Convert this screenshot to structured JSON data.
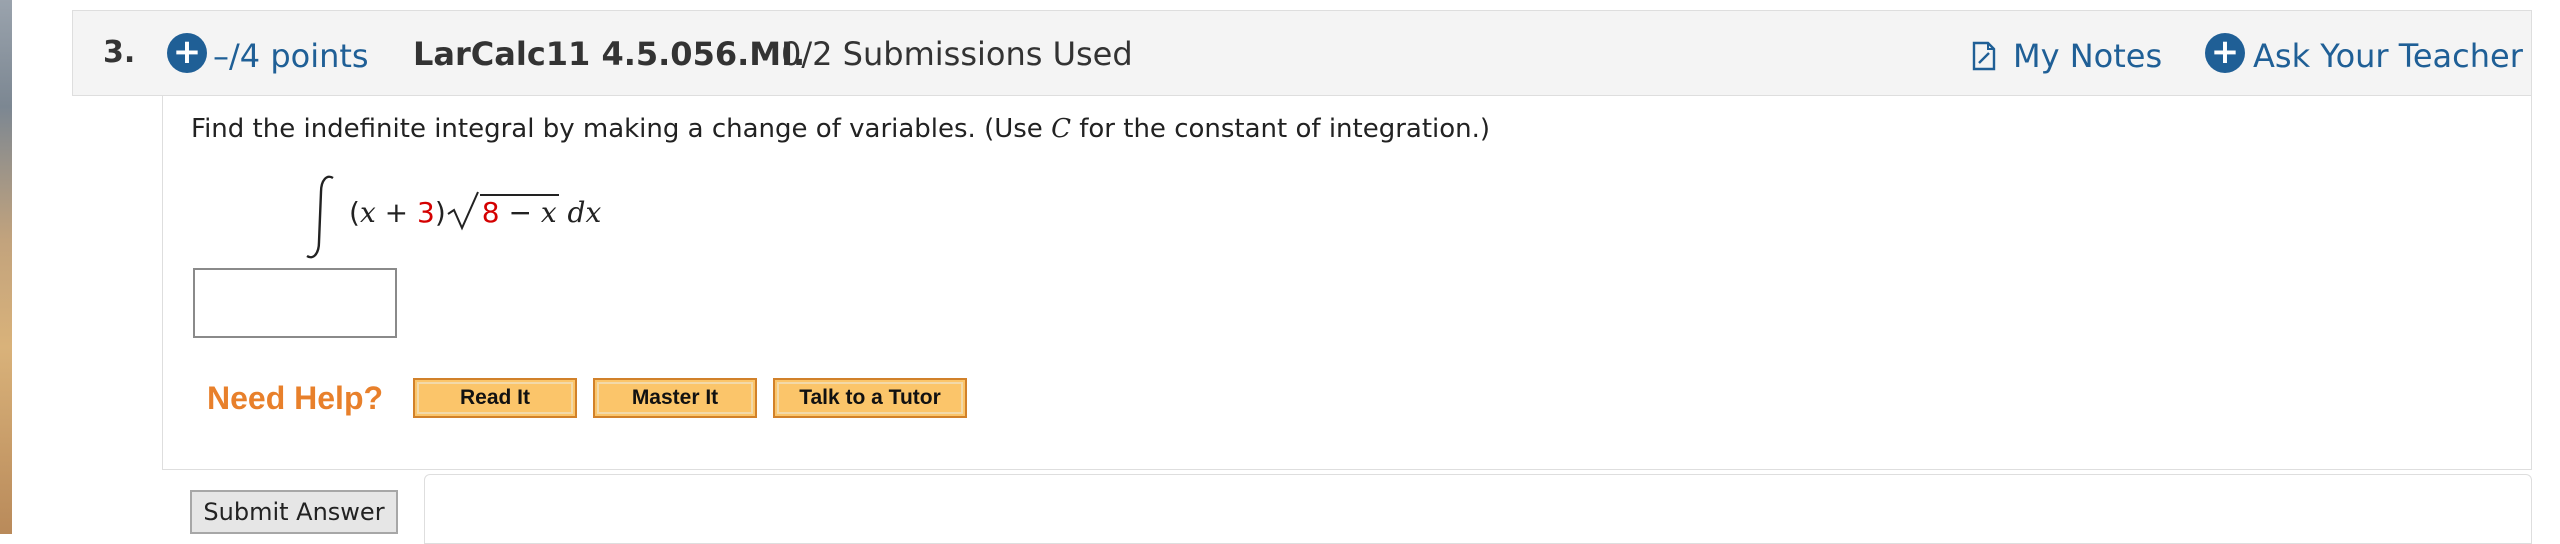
{
  "question": {
    "number": "3.",
    "points": "–/4 points",
    "assignment_id": "LarCalc11 4.5.056.MI.",
    "submissions": "0/2 Submissions Used",
    "my_notes": "My Notes",
    "ask_teacher": "Ask Your Teacher",
    "accent_color": "#1f5f96"
  },
  "prompt": {
    "before": "Find the indefinite integral by making a change of variables. (Use ",
    "var": "C",
    "after": " for the constant of integration.)"
  },
  "integral": {
    "open": "(",
    "x1": "x",
    "plus": " + ",
    "const": "3",
    "close": ")",
    "rad_const": "8",
    "minus": " − ",
    "x2": "x",
    "dx": " dx",
    "highlight_color": "#d40000"
  },
  "answer": {
    "value": ""
  },
  "help": {
    "label": "Need Help?",
    "buttons": [
      "Read It",
      "Master It",
      "Talk to a Tutor"
    ]
  },
  "submit": {
    "label": "Submit Answer"
  }
}
